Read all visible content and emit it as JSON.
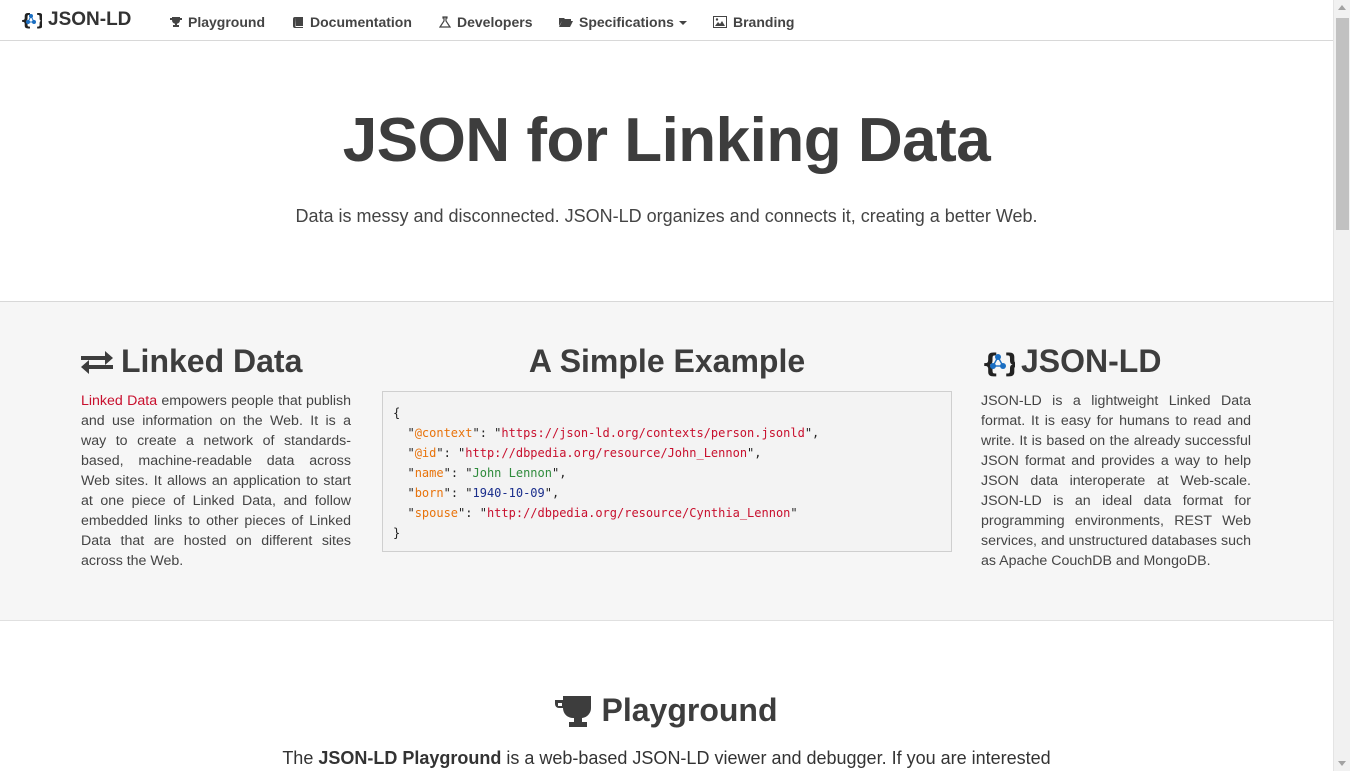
{
  "nav": {
    "brand": "JSON-LD",
    "items": [
      {
        "label": "Playground",
        "icon": "trophy-icon"
      },
      {
        "label": "Documentation",
        "icon": "book-icon"
      },
      {
        "label": "Developers",
        "icon": "flask-icon"
      },
      {
        "label": "Specifications",
        "icon": "folder-open-icon"
      },
      {
        "label": "Branding",
        "icon": "image-icon"
      }
    ]
  },
  "hero": {
    "title": "JSON for Linking Data",
    "subtitle": "Data is messy and disconnected. JSON-LD organizes and connects it, creating a better Web."
  },
  "linked_data": {
    "title": "Linked Data",
    "link_text": "Linked Data",
    "body": " empowers people that publish and use information on the Web. It is a way to create a network of standards-based, machine-readable data across Web sites. It allows an application to start at one piece of Linked Data, and follow embedded links to other pieces of Linked Data that are hosted on different sites across the Web."
  },
  "example": {
    "title": "A Simple Example",
    "open": "{",
    "close": "}",
    "pairs": [
      {
        "key": "@context",
        "value": "https://json-ld.org/contexts/person.jsonld"
      },
      {
        "key": "@id",
        "value": "http://dbpedia.org/resource/John_Lennon"
      },
      {
        "key": "name",
        "value": "John Lennon"
      },
      {
        "key": "born",
        "value": "1940-10-09"
      },
      {
        "key": "spouse",
        "value": "http://dbpedia.org/resource/Cynthia_Lennon"
      }
    ]
  },
  "jsonld": {
    "title": "JSON-LD",
    "body": "JSON-LD is a lightweight Linked Data format. It is easy for humans to read and write. It is based on the already successful JSON format and provides a way to help JSON data interoperate at Web-scale. JSON-LD is an ideal data format for programming environments, REST Web services, and unstructured databases such as Apache CouchDB and MongoDB."
  },
  "playground": {
    "title": "Playground",
    "text_pre": "The ",
    "text_bold": "JSON-LD Playground",
    "text_post": " is a web-based JSON-LD viewer and debugger. If you are interested"
  },
  "colors": {
    "accent_red": "#c8102e",
    "key_orange": "#e8730b",
    "string_green": "#2f8b3c",
    "number_blue": "#1a2e8c",
    "logo_blue": "#1a6ec2"
  }
}
